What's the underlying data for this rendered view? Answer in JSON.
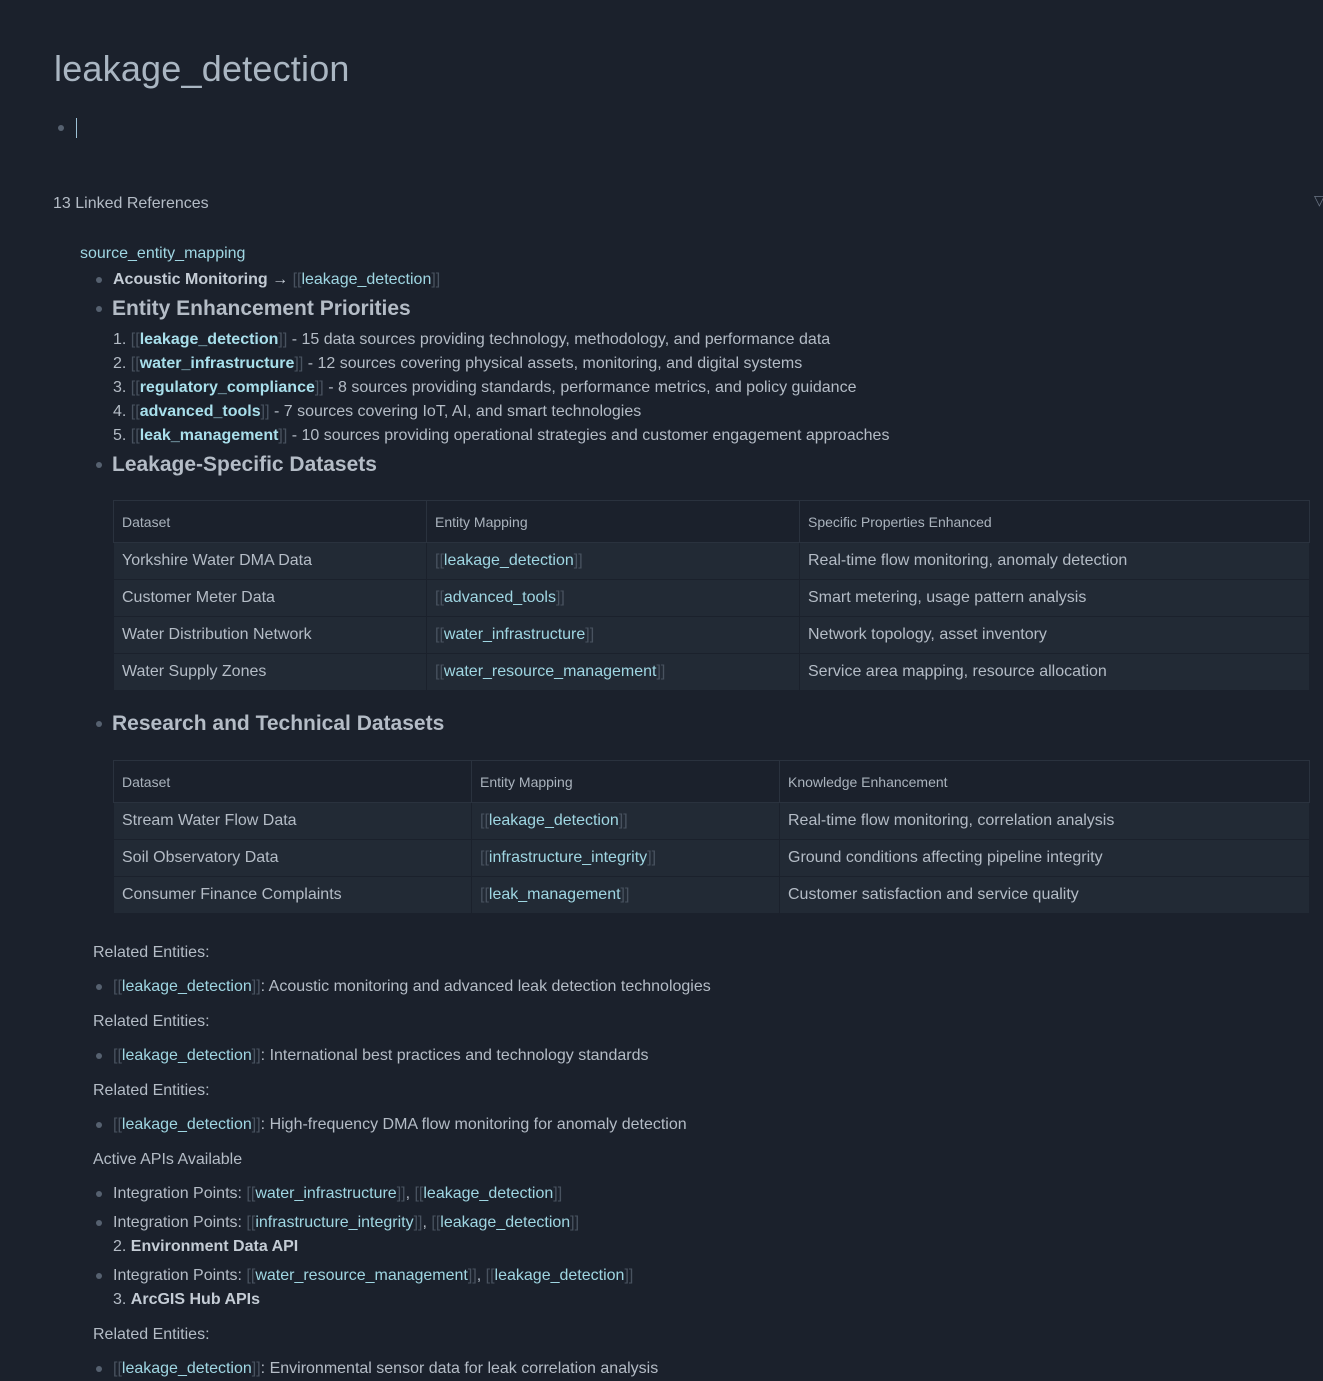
{
  "page": {
    "title": "leakage_detection"
  },
  "linked_refs": {
    "count_label": "13 Linked References",
    "source_page": "source_entity_mapping"
  },
  "acoustic": {
    "label": "Acoustic Monitoring",
    "arrow": "→",
    "link": "leakage_detection"
  },
  "priorities": {
    "heading": "Entity Enhancement Priorities",
    "items": [
      {
        "num": "1.",
        "link": "leakage_detection",
        "text": " - 15 data sources providing technology, methodology, and performance data"
      },
      {
        "num": "2.",
        "link": "water_infrastructure",
        "text": " - 12 sources covering physical assets, monitoring, and digital systems"
      },
      {
        "num": "3.",
        "link": "regulatory_compliance",
        "text": " - 8 sources providing standards, performance metrics, and policy guidance"
      },
      {
        "num": "4.",
        "link": "advanced_tools",
        "text": " - 7 sources covering IoT, AI, and smart technologies"
      },
      {
        "num": "5.",
        "link": "leak_management",
        "text": " - 10 sources providing operational strategies and customer engagement approaches"
      }
    ]
  },
  "leakage_table": {
    "heading": "Leakage-Specific Datasets",
    "headers": [
      "Dataset",
      "Entity Mapping",
      "Specific Properties Enhanced"
    ],
    "rows": [
      {
        "dataset": "Yorkshire Water DMA Data",
        "entity": "leakage_detection",
        "desc": "Real-time flow monitoring, anomaly detection"
      },
      {
        "dataset": "Customer Meter Data",
        "entity": "advanced_tools",
        "desc": "Smart metering, usage pattern analysis"
      },
      {
        "dataset": "Water Distribution Network",
        "entity": "water_infrastructure",
        "desc": "Network topology, asset inventory"
      },
      {
        "dataset": "Water Supply Zones",
        "entity": "water_resource_management",
        "desc": "Service area mapping, resource allocation"
      }
    ]
  },
  "research_table": {
    "heading": "Research and Technical Datasets",
    "headers": [
      "Dataset",
      "Entity Mapping",
      "Knowledge Enhancement"
    ],
    "rows": [
      {
        "dataset": "Stream Water Flow Data",
        "entity": "leakage_detection",
        "desc": "Real-time flow monitoring, correlation analysis"
      },
      {
        "dataset": "Soil Observatory Data",
        "entity": "infrastructure_integrity",
        "desc": "Ground conditions affecting pipeline integrity"
      },
      {
        "dataset": "Consumer Finance Complaints",
        "entity": "leak_management",
        "desc": "Customer satisfaction and service quality"
      }
    ]
  },
  "related_blocks": [
    {
      "label": "Related Entities:",
      "link": "leakage_detection",
      "text": ": Acoustic monitoring and advanced leak detection technologies"
    },
    {
      "label": "Related Entities:",
      "link": "leakage_detection",
      "text": ": International best practices and technology standards"
    },
    {
      "label": "Related Entities:",
      "link": "leakage_detection",
      "text": ": High-frequency DMA flow monitoring for anomaly detection"
    }
  ],
  "apis": {
    "label": "Active APIs Available",
    "integration_label": "Integration Points: ",
    "items": [
      {
        "link1": "water_infrastructure",
        "link2": "leakage_detection",
        "sub_num": "",
        "sub_title": ""
      },
      {
        "link1": "infrastructure_integrity",
        "link2": "leakage_detection",
        "sub_num": "2.",
        "sub_title": "Environment Data API"
      },
      {
        "link1": "water_resource_management",
        "link2": "leakage_detection",
        "sub_num": "3.",
        "sub_title": "ArcGIS Hub APIs"
      }
    ]
  },
  "final_related": {
    "label": "Related Entities:",
    "link": "leakage_detection",
    "text": ": Environmental sensor data for leak correlation analysis"
  },
  "brackets": {
    "open": "[[",
    "close": "]]",
    "comma": ", "
  },
  "colors": {
    "background": "#1b212c",
    "text": "#b4bcc6",
    "link": "#9fd6e2",
    "bracket": "#48525f"
  }
}
